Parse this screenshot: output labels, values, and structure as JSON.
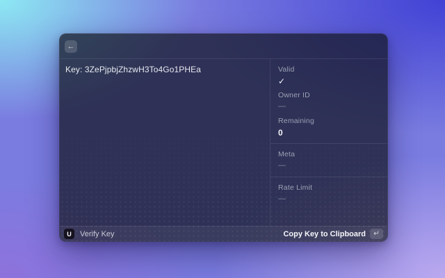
{
  "window": {
    "titlebar": {
      "back_icon": "←"
    },
    "main": {
      "key_display": "Key: 3ZePjpbjZhzwH3To4Go1PHEa"
    },
    "details": {
      "sections": [
        {
          "fields": [
            {
              "label": "Valid",
              "value": "✓"
            },
            {
              "label": "Owner ID",
              "value": "—"
            },
            {
              "label": "Remaining",
              "value": "0"
            }
          ]
        },
        {
          "fields": [
            {
              "label": "Meta",
              "value": "—"
            }
          ]
        },
        {
          "fields": [
            {
              "label": "Rate Limit",
              "value": "—"
            }
          ]
        }
      ]
    },
    "footer": {
      "logo_glyph": "U",
      "verify_label": "Verify Key",
      "copy_label": "Copy Key to Clipboard",
      "enter_icon": "↵"
    }
  },
  "colors": {
    "bg_top_left": "#8de9f3",
    "bg_top_right": "#4142d5",
    "bg_bottom_left": "#8e72dc",
    "bg_bottom_right": "#bba9ef",
    "window_overlay": "rgba(18,21,33,0.72)"
  }
}
